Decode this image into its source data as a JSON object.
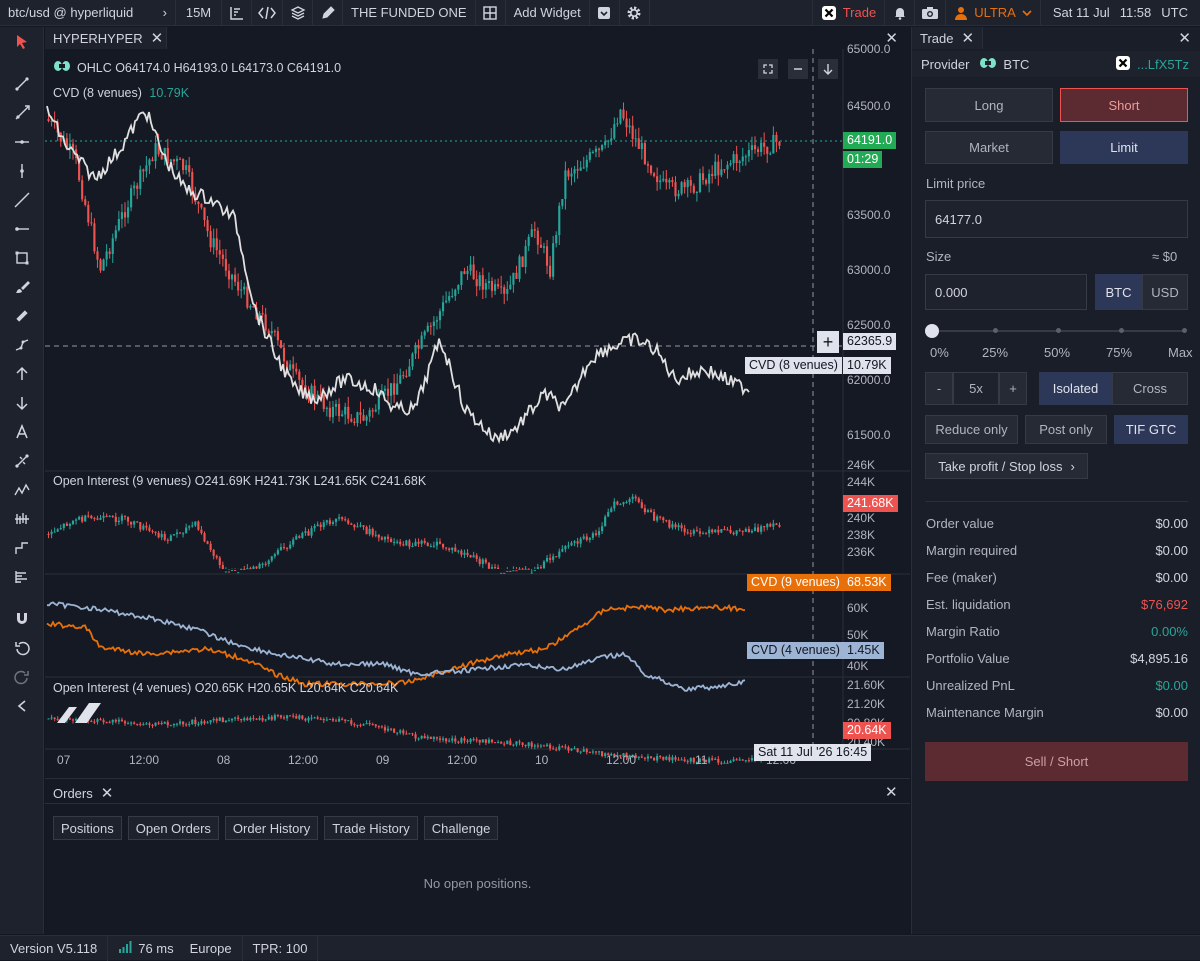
{
  "topbar": {
    "symbol": "btc/usd @ hyperliquid",
    "interval": "15M",
    "funded": "THE FUNDED ONE",
    "add_widget": "Add Widget",
    "trade": "Trade",
    "plan": "ULTRA",
    "date": "Sat 11 Jul",
    "time": "11:58",
    "tz": "UTC"
  },
  "chart": {
    "tab_title": "HYPERHYPER",
    "ohlc": "OHLC  O64174.0 H64193.0 L64173.0 C64191.0",
    "cvd8_legend": "CVD (8 venues)",
    "cvd8_value": "10.79K",
    "oi9_legend": "Open Interest (9 venues)  O241.69K H241.73K L241.65K C241.68K",
    "oi4_legend": "Open Interest (4 venues)  O20.65K H20.65K L20.64K C20.64K",
    "price_axis": [
      "65000.0",
      "64500.0",
      "63500.0",
      "63000.0",
      "62500.0",
      "62000.0",
      "61500.0"
    ],
    "last_price": "64191.0",
    "countdown": "01:29",
    "crosshair_price": "62365.9",
    "cvd8_tag": "CVD (8 venues)",
    "cvd8_tag_value": "10.79K",
    "oi9_axis": [
      "246K",
      "244K",
      "240K",
      "238K",
      "236K"
    ],
    "oi9_last": "241.68K",
    "cvd9_tag": "CVD (9 venues)",
    "cvd9_value": "68.53K",
    "cvd_axis": [
      "60K",
      "50K",
      "40K"
    ],
    "cvd4_tag": "CVD (4 venues)",
    "cvd4_value": "1.45K",
    "oi4_axis": [
      "21.60K",
      "21.20K",
      "20.80K",
      "20.40K"
    ],
    "oi4_last": "20.64K",
    "time_axis": [
      "07",
      "12:00",
      "08",
      "12:00",
      "09",
      "12:00",
      "10",
      "12:00",
      "11",
      "12:00"
    ],
    "crosshair_time": "Sat 11 Jul '26 16:45",
    "colors": {
      "up": "#26a69a",
      "down": "#ef5350",
      "cvd9": "#e8700a",
      "cvd4": "#9db4d4",
      "cvd8": "#e0e0e0",
      "price_tag": "#22ab55"
    }
  },
  "orders": {
    "title": "Orders",
    "tabs": [
      "Positions",
      "Open Orders",
      "Order History",
      "Trade History",
      "Challenge"
    ],
    "empty": "No open positions."
  },
  "status": {
    "version": "Version V5.118",
    "latency": "76 ms",
    "region": "Europe",
    "tpr": "TPR: 100"
  },
  "trade": {
    "title": "Trade",
    "provider_label": "Provider",
    "provider_asset": "BTC",
    "account": "...LfX5Tz",
    "long": "Long",
    "short": "Short",
    "market": "Market",
    "limit": "Limit",
    "limit_price_label": "Limit price",
    "limit_price": "64177.0",
    "size_label": "Size",
    "size_usd_hint": "≈ $0",
    "size_value": "0.000",
    "unit_btc": "BTC",
    "unit_usd": "USD",
    "slider_marks": [
      "0%",
      "25%",
      "50%",
      "75%",
      "Max"
    ],
    "slider_fraction": 0,
    "lev_minus": "-",
    "leverage": "5x",
    "lev_plus": "+",
    "isolated": "Isolated",
    "cross": "Cross",
    "reduce_only": "Reduce only",
    "post_only": "Post only",
    "tif": "TIF GTC",
    "tpsl": "Take profit / Stop loss",
    "rows": [
      {
        "k": "Order value",
        "v": "$0.00"
      },
      {
        "k": "Margin required",
        "v": "$0.00"
      },
      {
        "k": "Fee (maker)",
        "v": "$0.00"
      },
      {
        "k": "Est. liquidation",
        "v": "$76,692"
      },
      {
        "k": "Margin Ratio",
        "v": "0.00%"
      },
      {
        "k": "Portfolio Value",
        "v": "$4,895.16"
      },
      {
        "k": "Unrealized PnL",
        "v": "$0.00"
      },
      {
        "k": "Maintenance Margin",
        "v": "$0.00"
      }
    ],
    "row_colors": [
      "",
      "",
      "",
      "#ef5350",
      "#26a69a",
      "",
      "#26a69a",
      ""
    ],
    "submit": "Sell / Short"
  }
}
